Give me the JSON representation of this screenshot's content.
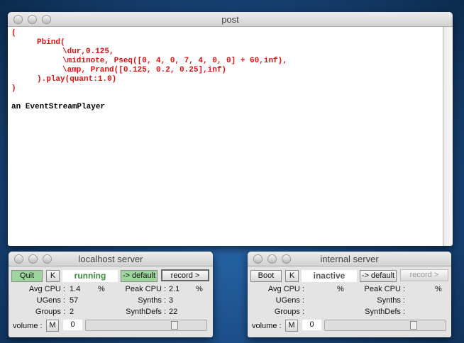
{
  "post": {
    "title": "post",
    "code": [
      "(",
      "\tPbind(",
      "\t\t\\dur,0.125,",
      "\t\t\\midinote, Pseq([0, 4, 0, 7, 4, 0, 0] + 60,inf),",
      "\t\t\\amp, Prand([0.125, 0.2, 0.25],inf)",
      "\t).play(quant:1.0)",
      ")"
    ],
    "output": "an EventStreamPlayer"
  },
  "localhost": {
    "title": "localhost server",
    "boot": "Quit",
    "kill": "K",
    "status": "running",
    "default": "-> default",
    "record": "record >",
    "avg_cpu_label": "Avg CPU :",
    "avg_cpu": "1.4",
    "pct": "%",
    "peak_cpu_label": "Peak CPU :",
    "peak_cpu": "2.1",
    "ugens_label": "UGens :",
    "ugens": "57",
    "synths_label": "Synths :",
    "synths": "3",
    "groups_label": "Groups :",
    "groups": "2",
    "synthdefs_label": "SynthDefs :",
    "synthdefs": "22",
    "volume_label": "volume :",
    "mute": "M",
    "volume": "0",
    "volume_fraction": 0.75
  },
  "internal": {
    "title": "internal server",
    "boot": "Boot",
    "kill": "K",
    "status": "inactive",
    "default": "-> default",
    "record": "record >",
    "avg_cpu_label": "Avg CPU :",
    "avg_cpu": "",
    "pct": "%",
    "peak_cpu_label": "Peak CPU :",
    "peak_cpu": "",
    "ugens_label": "UGens :",
    "ugens": "",
    "synths_label": "Synths :",
    "synths": "",
    "groups_label": "Groups :",
    "groups": "",
    "synthdefs_label": "SynthDefs :",
    "synthdefs": "",
    "volume_label": "volume :",
    "mute": "M",
    "volume": "0",
    "volume_fraction": 0.75
  }
}
